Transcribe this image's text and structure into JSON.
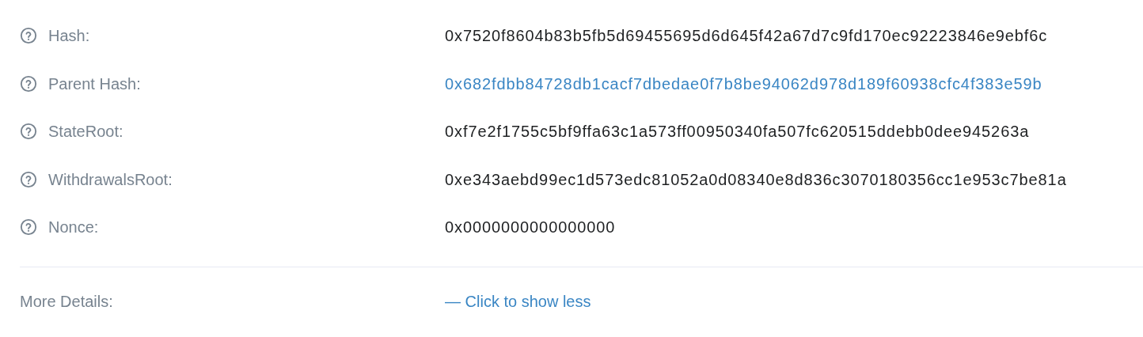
{
  "fields": [
    {
      "label": "Hash:",
      "value": "0x7520f8604b83b5fb5d69455695d6d645f42a67d7c9fd170ec92223846e9ebf6c",
      "kind": "text"
    },
    {
      "label": "Parent Hash:",
      "value": "0x682fdbb84728db1cacf7dbedae0f7b8be94062d978d189f60938cfc4f383e59b",
      "kind": "link"
    },
    {
      "label": "StateRoot:",
      "value": "0xf7e2f1755c5bf9ffa63c1a573ff00950340fa507fc620515ddebb0dee945263a",
      "kind": "text"
    },
    {
      "label": "WithdrawalsRoot:",
      "value": "0xe343aebd99ec1d573edc81052a0d08340e8d836c3070180356cc1e953c7be81a",
      "kind": "text"
    },
    {
      "label": "Nonce:",
      "value": "0x0000000000000000",
      "kind": "text"
    }
  ],
  "more_details": {
    "label": "More Details:",
    "link": "— Click to show less"
  }
}
